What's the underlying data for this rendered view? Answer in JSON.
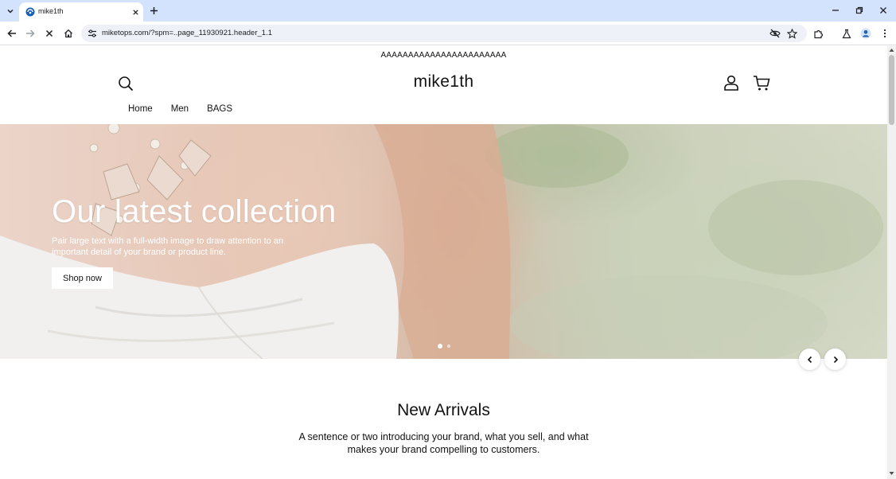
{
  "browser": {
    "tab_title": "mike1th",
    "url": "miketops.com/?spm=..page_11930921.header_1.1"
  },
  "store": {
    "announcement": "AAAAAAAAAAAAAAAAAAAAAAA",
    "logo": "mike1th",
    "nav": [
      {
        "label": "Home"
      },
      {
        "label": "Men"
      },
      {
        "label": "BAGS"
      }
    ]
  },
  "hero": {
    "heading": "Our latest collection",
    "text": "Pair large text with a full-width image to draw attention to an important detail of your brand or product line.",
    "button_label": "Shop now",
    "slide_count": 2,
    "active_slide": 1
  },
  "section": {
    "title": "New Arrivals",
    "text": "A sentence or two introducing your brand, what you sell, and what makes your brand compelling to customers."
  },
  "colors": {
    "tabstrip": "#d3e3fd",
    "omnibox": "#eef1f8",
    "text": "#121212"
  },
  "icons": {
    "tab_list": "chevron-down-icon",
    "favicon": "site-favicon-icon",
    "close_tab": "close-icon",
    "new_tab": "plus-icon",
    "back": "arrow-left-icon",
    "forward": "arrow-right-icon",
    "stop": "close-icon",
    "home": "home-icon",
    "site_info": "tune-icon",
    "eye_off": "eye-off-icon",
    "bookmark": "star-icon",
    "extensions": "puzzle-icon",
    "labs": "flask-icon",
    "profile": "person-icon",
    "menu": "more-vert-icon",
    "search": "search-icon",
    "account": "user-icon",
    "cart": "cart-icon"
  }
}
